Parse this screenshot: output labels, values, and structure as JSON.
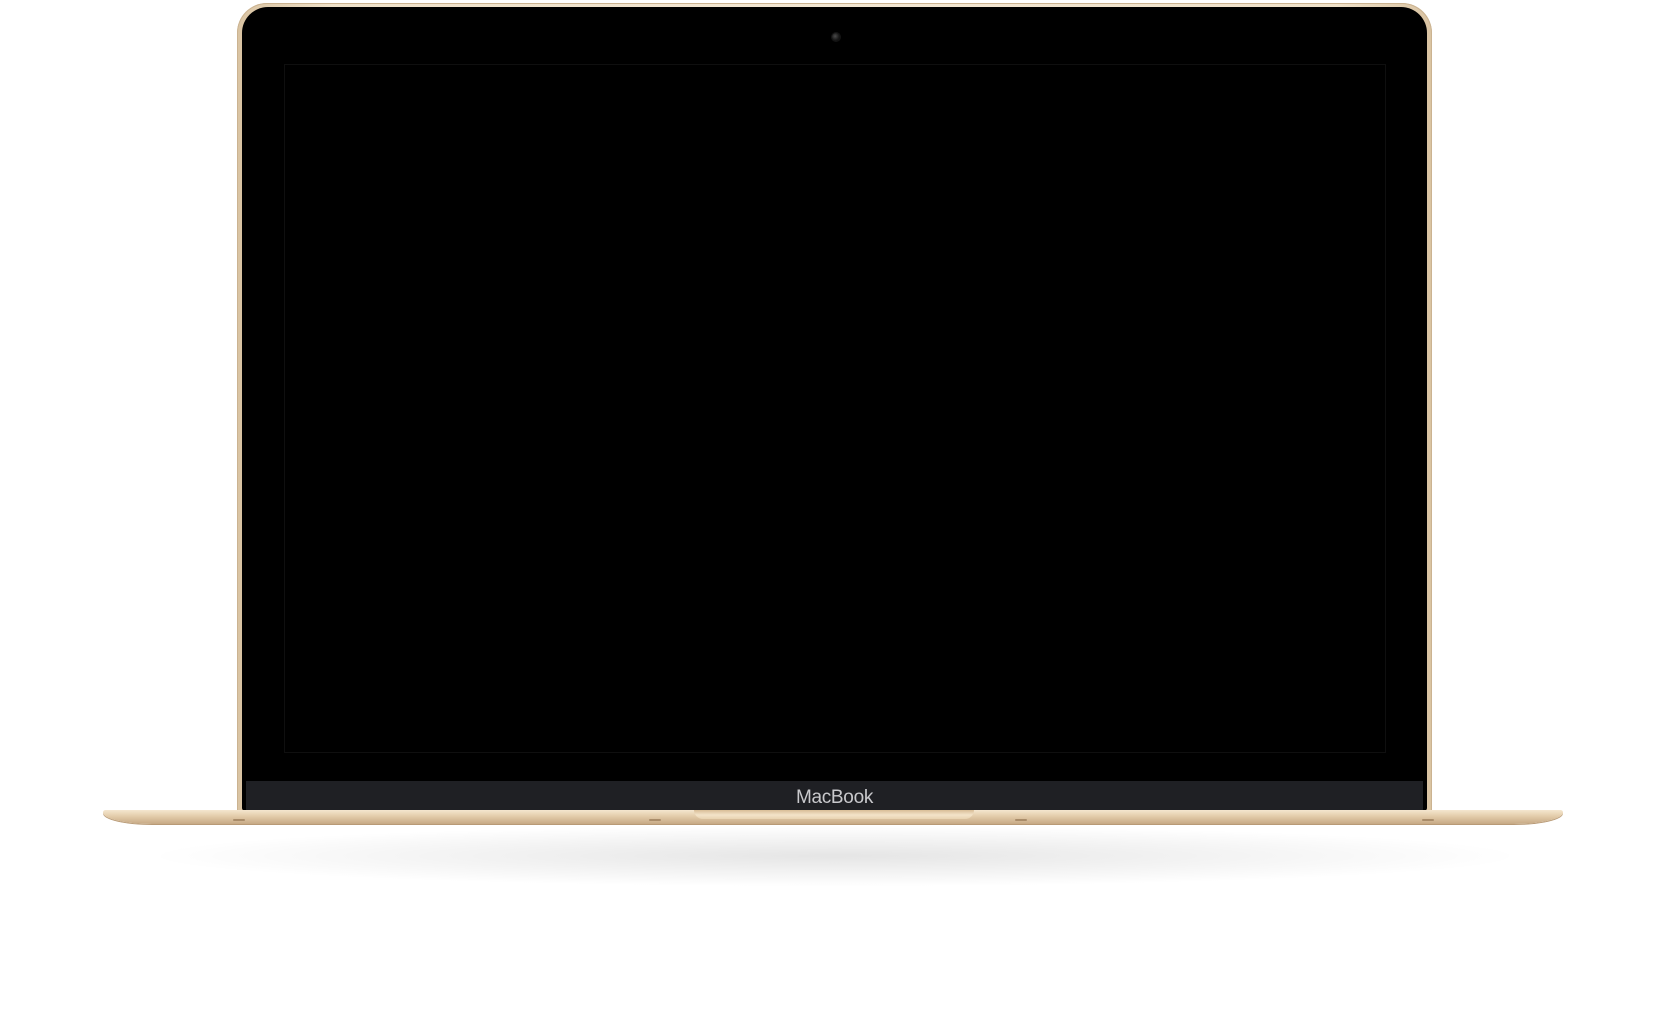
{
  "device": {
    "brand_label": "MacBook",
    "finish_color": "#efe1c9",
    "bezel_color": "#000000",
    "chin_color": "#1f2024",
    "brand_text_color": "#c9c9cc"
  },
  "screen": {
    "state": "off",
    "background": "#000000"
  }
}
